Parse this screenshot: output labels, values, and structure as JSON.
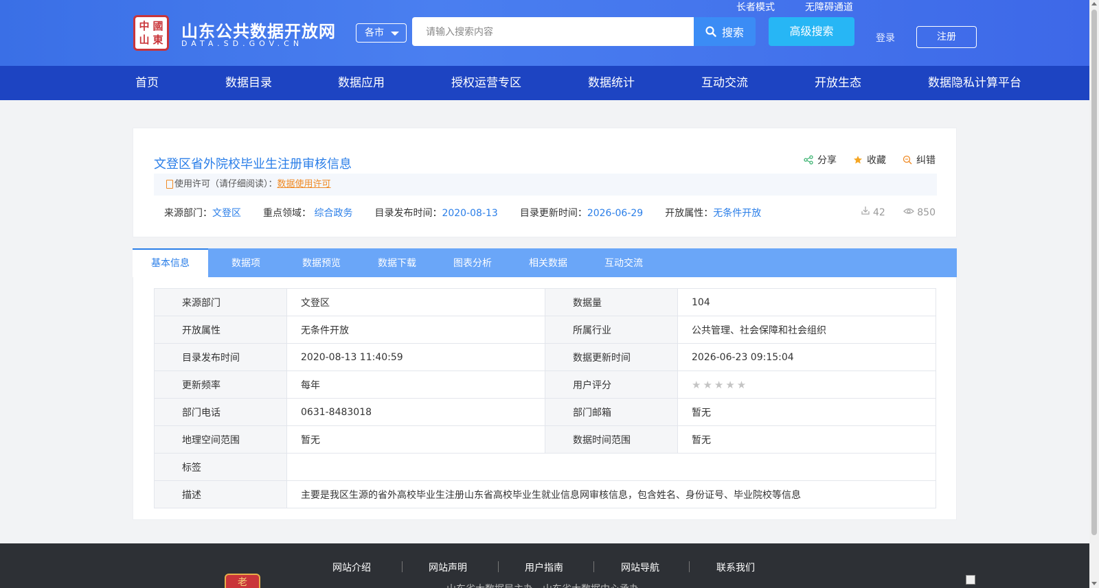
{
  "header": {
    "logo_glyphs": [
      "中",
      "國",
      "山",
      "東"
    ],
    "site_title": "山东公共数据开放网",
    "site_sub": "DATA.SD.GOV.CN",
    "city_select": "各市",
    "search_placeholder": "请输入搜索内容",
    "search_label": "搜索",
    "advanced_search_label": "高级搜索",
    "elder_mode": "长者模式",
    "accessibility": "无障碍通道",
    "login": "登录",
    "register": "注册"
  },
  "nav": [
    "首页",
    "数据目录",
    "数据应用",
    "授权运营专区",
    "数据统计",
    "互动交流",
    "开放生态",
    "数据隐私计算平台"
  ],
  "dataset": {
    "title": "文登区省外院校毕业生注册审核信息",
    "actions": {
      "share": "分享",
      "favorite": "收藏",
      "report": "纠错"
    },
    "license_prefix": "使用许可（请仔细阅读）：",
    "license_link": "数据使用许可",
    "meta": [
      {
        "label": "来源部门：",
        "value": "文登区"
      },
      {
        "label": "重点领域：",
        "value": " 综合政务"
      },
      {
        "label": "目录发布时间：",
        "value": "2020-08-13"
      },
      {
        "label": "目录更新时间：",
        "value": "2026-06-29"
      },
      {
        "label": "开放属性：",
        "value": "无条件开放"
      }
    ],
    "downloads": "42",
    "views": "850"
  },
  "tabs": [
    "基本信息",
    "数据项",
    "数据预览",
    "数据下载",
    "图表分析",
    "相关数据",
    "互动交流"
  ],
  "info": {
    "rows": [
      [
        "来源部门",
        "文登区",
        "数据量",
        "104"
      ],
      [
        "开放属性",
        "无条件开放",
        "所属行业",
        "公共管理、社会保障和社会组织"
      ],
      [
        "目录发布时间",
        "2020-08-13 11:40:59",
        "数据更新时间",
        "2026-06-23 09:15:04"
      ],
      [
        "更新频率",
        "每年",
        "用户评分",
        ""
      ],
      [
        "部门电话",
        "0631-8483018",
        "部门邮箱",
        "暂无"
      ],
      [
        "地理空间范围",
        "暂无",
        "数据时间范围",
        "暂无"
      ]
    ],
    "rating": {
      "stars": 0,
      "max": 5
    },
    "tag_label": "标签",
    "tag_value": "",
    "desc_label": "描述",
    "desc_value": "主要是我区生源的省外高校毕业生注册山东省高校毕业生就业信息网审核信息，包含姓名、身份证号、毕业院校等信息"
  },
  "footer": {
    "links": [
      "网站介绍",
      "网站声明",
      "用户指南",
      "网站导航",
      "联系我们"
    ],
    "text": "山东省大数据局主办　山东省大数据中心承办",
    "logo_glyph": "老"
  },
  "colors": {
    "accent": "#2a7ee8",
    "nav": "#1d44c2",
    "tabs": "#6aa6f8",
    "license_link": "#f08a24"
  }
}
